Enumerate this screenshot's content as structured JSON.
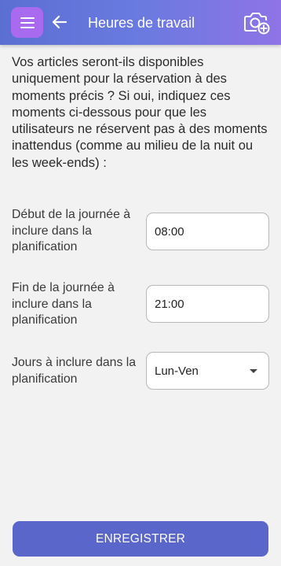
{
  "header": {
    "title": "Heures de travail"
  },
  "intro_text": "Vos articles seront-ils disponibles uniquement pour la réservation à des moments précis ? Si oui, indiquez ces moments ci-dessous pour que les utilisateurs ne réservent pas à des moments inattendus (comme au milieu de la nuit ou les week-ends) :",
  "form": {
    "start": {
      "label": "Début de la journée à inclure dans la planification",
      "value": "08:00"
    },
    "end": {
      "label": "Fin de la journée à inclure dans la planification",
      "value": "21:00"
    },
    "days": {
      "label": "Jours à inclure dans la planification",
      "selected": "Lun-Ven"
    }
  },
  "save_label": "ENREGISTRER",
  "colors": {
    "header_start": "#5b6fd3",
    "header_end": "#8f74e6",
    "menu_button": "#a86bf0",
    "save_button": "#5a66c9",
    "background": "#f2f2f2"
  },
  "icons": {
    "menu": "hamburger-menu-icon",
    "back": "arrow-left-icon",
    "camera": "camera-add-icon",
    "dropdown": "caret-down-icon"
  }
}
